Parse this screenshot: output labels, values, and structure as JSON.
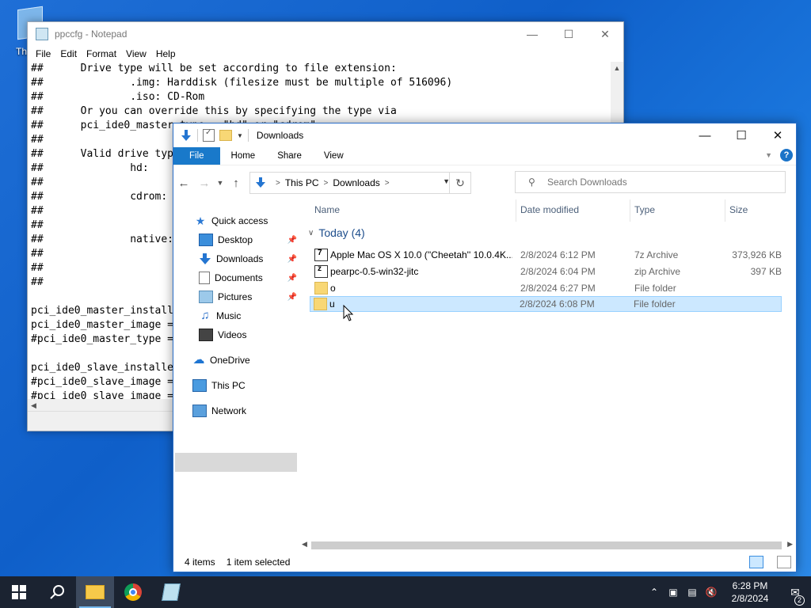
{
  "desktop": {
    "icon_label": "Th"
  },
  "notepad": {
    "title": "ppccfg - Notepad",
    "menu": [
      "File",
      "Edit",
      "Format",
      "View",
      "Help"
    ],
    "lines": [
      "##      Drive type will be set according to file extension:",
      "##              .img: Harddisk (filesize must be multiple of 516096)",
      "##              .iso: CD-Rom",
      "##      Or you can override this by specifying the type via",
      "##      pci_ide0_master_type = \"hd\" or \"cdrom\"",
      "##",
      "##      Valid drive types are:",
      "##              hd:",
      "##",
      "##              cdrom:",
      "##",
      "##",
      "##              native:",
      "##",
      "##",
      "##",
      "",
      "pci_ide0_master_installed = 1",
      "pci_ide0_master_image = ",
      "#pci_ide0_master_type = ",
      "",
      "pci_ide0_slave_installed = 1",
      "#pci_ide0_slave_image = ",
      "#pci_ide0_slave_image = "
    ]
  },
  "explorer": {
    "title": "Downloads",
    "ribbon_tabs": [
      "File",
      "Home",
      "Share",
      "View"
    ],
    "breadcrumb": [
      "This PC",
      "Downloads"
    ],
    "search_placeholder": "Search Downloads",
    "nav": {
      "quick_access": "Quick access",
      "desktop": "Desktop",
      "downloads": "Downloads",
      "documents": "Documents",
      "pictures": "Pictures",
      "music": "Music",
      "videos": "Videos",
      "onedrive": "OneDrive",
      "this_pc": "This PC",
      "network": "Network"
    },
    "columns": {
      "name": "Name",
      "date": "Date modified",
      "type": "Type",
      "size": "Size"
    },
    "group": "Today (4)",
    "files": [
      {
        "name": "Apple Mac OS X 10.0 (''Cheetah'' 10.0.4K...",
        "date": "2/8/2024 6:12 PM",
        "type": "7z Archive",
        "size": "373,926 KB",
        "icon": "7z-archive-icon"
      },
      {
        "name": "pearpc-0.5-win32-jitc",
        "date": "2/8/2024 6:04 PM",
        "type": "zip Archive",
        "size": "397 KB",
        "icon": "zip-archive-icon"
      },
      {
        "name": "o",
        "date": "2/8/2024 6:27 PM",
        "type": "File folder",
        "size": "",
        "icon": "folder-icon"
      },
      {
        "name": "u",
        "date": "2/8/2024 6:08 PM",
        "type": "File folder",
        "size": "",
        "icon": "folder-icon"
      }
    ],
    "status": {
      "items": "4 items",
      "selected": "1 item selected"
    }
  },
  "taskbar": {
    "time": "6:28 PM",
    "date": "2/8/2024",
    "notifications": "2"
  }
}
